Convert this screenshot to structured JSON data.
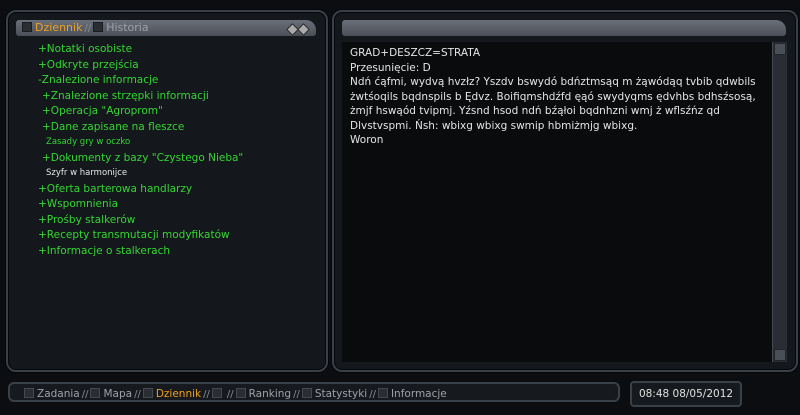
{
  "left_tabs": {
    "active": "Dziennik",
    "separator": "//",
    "inactive": "Historia"
  },
  "tree": {
    "items": [
      "+Notatki osobiste",
      "+Odkryte przejścia",
      "-Znalezione informacje",
      "+Znalezione strzępki informacji",
      "+Operacja \"Agroprom\"",
      "+Dane zapisane na fleszce",
      "Zasady gry w oczko",
      "+Dokumenty z bazy \"Czystego Nieba\"",
      "Szyfr w harmonijce",
      "+Oferta barterowa handlarzy",
      "+Wspomnienia",
      "+Prośby stalkerów",
      "+Recepty transmutacji modyfikatów",
      "+Informacje o stalkerach"
    ]
  },
  "message": {
    "line1": "GRAD+DESZCZ=STRATA",
    "line2": "Przesunięcie: D",
    "body": "Ndń ćąfmi, wydvą hvzłz? Yszdv bswydó bdńztmsąq m żąwódąq tvbib qdwbils żwtśoqils bqdnspils b Ędvz. Boifiqmshdźfd ęąó swydyqms ędvhbs bdhsźsosą, żmjf hswąód tvipmj. Yźsnd hsod ndń bźąłoi bqdnhzni wmj ż wflsźńz qd Dlvstvspmi. Ńsh: wbixg wbixg swmip hbmiżmjg wbixg.",
    "signature": "Woron"
  },
  "bottom_tabs": {
    "separator": "//",
    "items": [
      "Zadania",
      "Mapa",
      "Dziennik",
      "",
      "Ranking",
      "Statystyki",
      "Informacje"
    ]
  },
  "clock": {
    "text": "08:48 08/05/2012"
  },
  "colors": {
    "accent": "#f0a020",
    "tree_text": "#35d535",
    "selected_text": "#e8e8e8"
  },
  "icons": {
    "tab_controls": "diamond-arrows-icon"
  }
}
